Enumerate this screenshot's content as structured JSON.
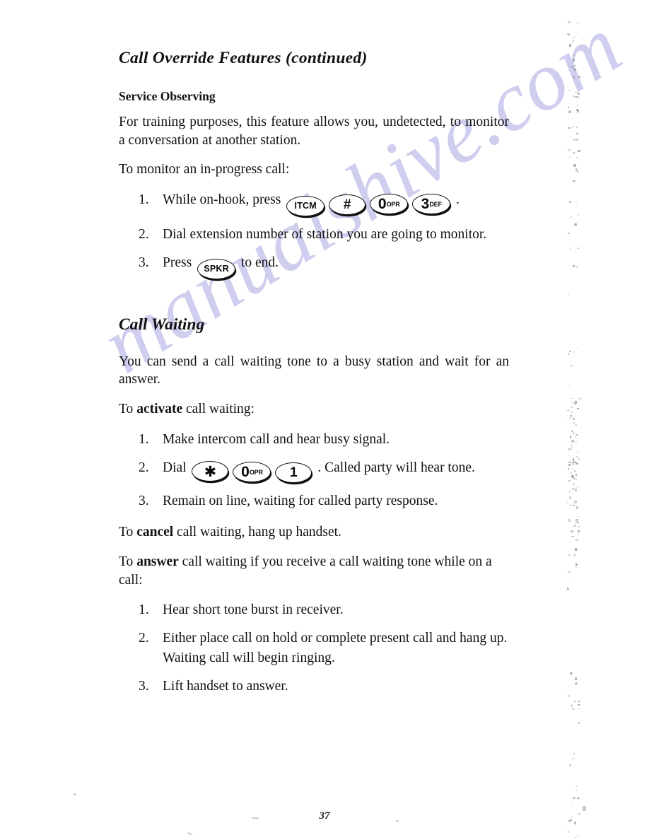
{
  "page": {
    "number": "37",
    "watermark": "manualshive.com"
  },
  "chapter": {
    "title": "Call Override Features (continued)"
  },
  "service_observing": {
    "heading": "Service Observing",
    "intro": "For training purposes, this feature allows you, undetected, to monitor a conversation at another station.",
    "lead_in": "To monitor an in-progress call:",
    "steps": [
      {
        "text_before": "While on-hook, press",
        "keys": [
          {
            "type": "word",
            "label": "ITCM"
          },
          {
            "type": "sym",
            "label": "#"
          },
          {
            "type": "digit",
            "label": "0",
            "sub": "OPR"
          },
          {
            "type": "digit",
            "label": "3",
            "sub": "DEF"
          }
        ],
        "text_after": "."
      },
      {
        "text_before": "Dial extension number of station you are going to monitor.",
        "keys": [],
        "text_after": ""
      },
      {
        "text_before": "Press",
        "keys": [
          {
            "type": "word",
            "label": "SPKR"
          }
        ],
        "text_after": "to end."
      }
    ]
  },
  "call_waiting": {
    "heading": "Call Waiting",
    "intro": "You can send a call waiting tone to a busy station and wait for an answer.",
    "activate_lead_in_prefix": "To ",
    "activate_lead_in_bold": "activate",
    "activate_lead_in_suffix": " call waiting:",
    "activate_steps": [
      {
        "text_before": "Make intercom call and hear busy signal.",
        "keys": [],
        "text_after": ""
      },
      {
        "text_before": "Dial",
        "keys": [
          {
            "type": "sym",
            "label": "✱"
          },
          {
            "type": "digit",
            "label": "0",
            "sub": "OPR"
          },
          {
            "type": "sym",
            "label": "1"
          }
        ],
        "text_after": ". Called party will hear tone."
      },
      {
        "text_before": "Remain on line, waiting for called party response.",
        "keys": [],
        "text_after": ""
      }
    ],
    "cancel_prefix": "To ",
    "cancel_bold": "cancel",
    "cancel_suffix": " call waiting, hang up handset.",
    "answer_prefix": "To ",
    "answer_bold": "answer",
    "answer_suffix": " call waiting if you receive a call waiting tone while on a call:",
    "answer_steps": [
      "Hear short tone burst in receiver.",
      "Either place call on hold or complete present call and hang up. Waiting call will begin ringing.",
      "Lift handset to answer."
    ]
  }
}
